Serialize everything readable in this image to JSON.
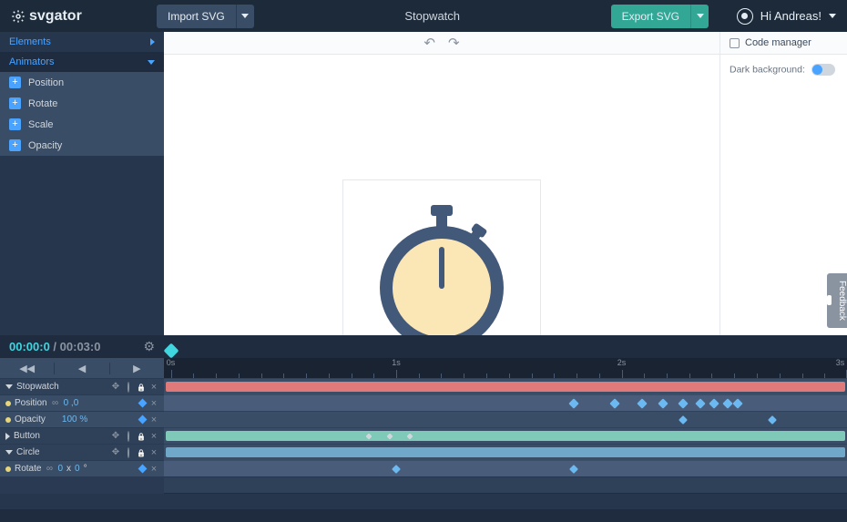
{
  "app": {
    "name": "svgator"
  },
  "header": {
    "import_label": "Import SVG",
    "title": "Stopwatch",
    "export_label": "Export SVG",
    "user_greeting": "Hi Andreas!"
  },
  "panels": {
    "elements_label": "Elements",
    "animators_label": "Animators",
    "animator_items": [
      {
        "label": "Position"
      },
      {
        "label": "Rotate"
      },
      {
        "label": "Scale"
      },
      {
        "label": "Opacity"
      }
    ]
  },
  "right": {
    "code_manager_label": "Code manager",
    "dark_bg_label": "Dark background:"
  },
  "canvas": {
    "width": "300",
    "height": "300",
    "x": "X"
  },
  "timeline": {
    "current": "00:00:0",
    "sep": " / ",
    "total": "00:03:0",
    "ticks": [
      "0s",
      "1s",
      "2s",
      "3s"
    ],
    "tracks": [
      {
        "kind": "obj",
        "name": "Stopwatch",
        "expand": "down"
      },
      {
        "kind": "prop",
        "name": "Position",
        "value": "0 ,0"
      },
      {
        "kind": "prop",
        "name": "Opacity",
        "value": "100 %"
      },
      {
        "kind": "obj",
        "name": "Button",
        "expand": "right"
      },
      {
        "kind": "obj",
        "name": "Circle",
        "expand": "down"
      },
      {
        "kind": "prop",
        "name": "Rotate",
        "value_a": "0",
        "x": "x",
        "value_b": "0",
        "deg": "°"
      }
    ]
  },
  "feedback": {
    "label": "Feedback"
  }
}
